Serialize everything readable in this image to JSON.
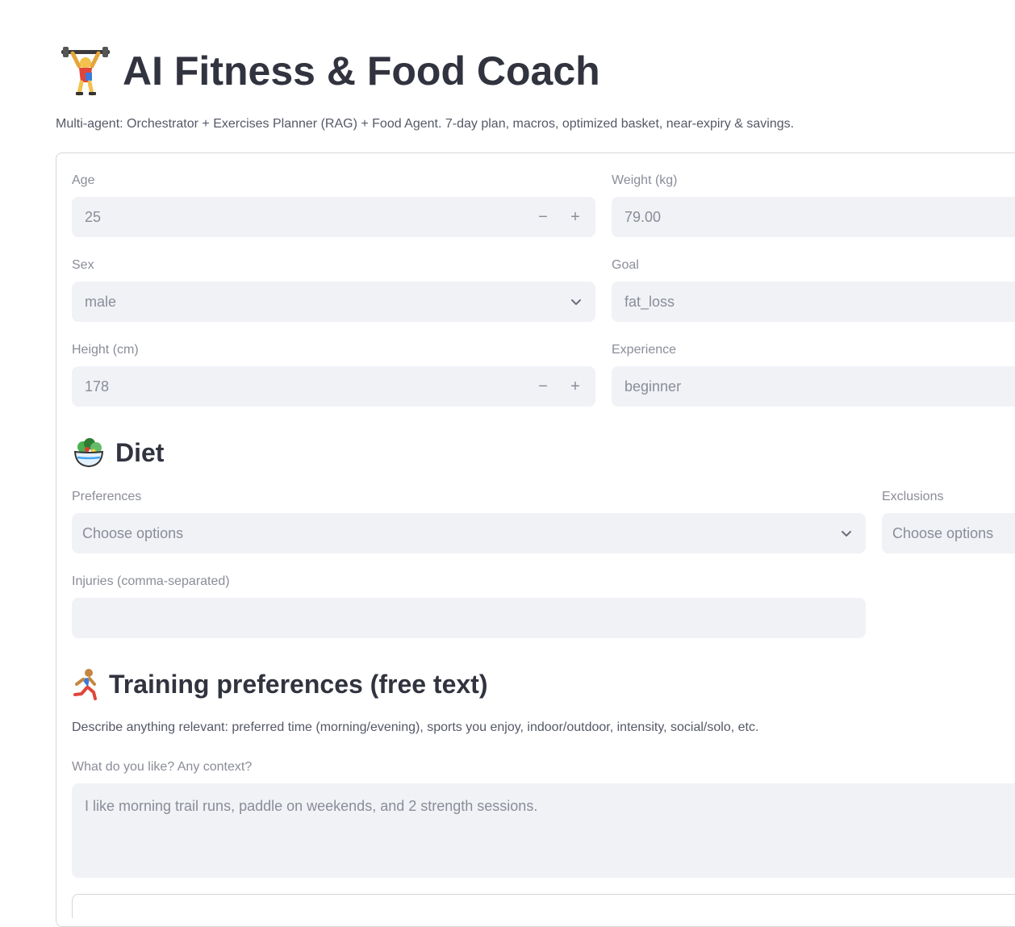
{
  "app": {
    "title": "AI Fitness & Food Coach",
    "subtitle": "Multi-agent: Orchestrator + Exercises Planner (RAG) + Food Agent. 7-day plan, macros, optimized basket, near-expiry & savings.",
    "title_icon": "weightlifter-icon"
  },
  "profile": {
    "age": {
      "label": "Age",
      "value": "25"
    },
    "weight": {
      "label": "Weight (kg)",
      "value": "79.00"
    },
    "sex": {
      "label": "Sex",
      "value": "male"
    },
    "goal": {
      "label": "Goal",
      "value": "fat_loss"
    },
    "height": {
      "label": "Height (cm)",
      "value": "178"
    },
    "experience": {
      "label": "Experience",
      "value": "beginner"
    },
    "minus": "−",
    "plus": "+"
  },
  "diet": {
    "heading": "Diet",
    "icon": "salad-icon",
    "preferences": {
      "label": "Preferences",
      "placeholder": "Choose options"
    },
    "exclusions": {
      "label": "Exclusions",
      "placeholder": "Choose options"
    },
    "injuries": {
      "label": "Injuries (comma-separated)",
      "value": ""
    }
  },
  "training": {
    "heading": "Training preferences (free text)",
    "icon": "runner-icon",
    "description": "Describe anything relevant: preferred time (morning/evening), sports you enjoy, indoor/outdoor, intensity, social/solo, etc.",
    "context": {
      "label": "What do you like? Any context?",
      "placeholder": "I like morning trail runs, paddle on weekends, and 2 strength sessions."
    }
  },
  "colors": {
    "field_bg": "#f0f2f6",
    "text": "#31333f",
    "muted": "#8a8d98",
    "border": "#d6d6d9"
  }
}
